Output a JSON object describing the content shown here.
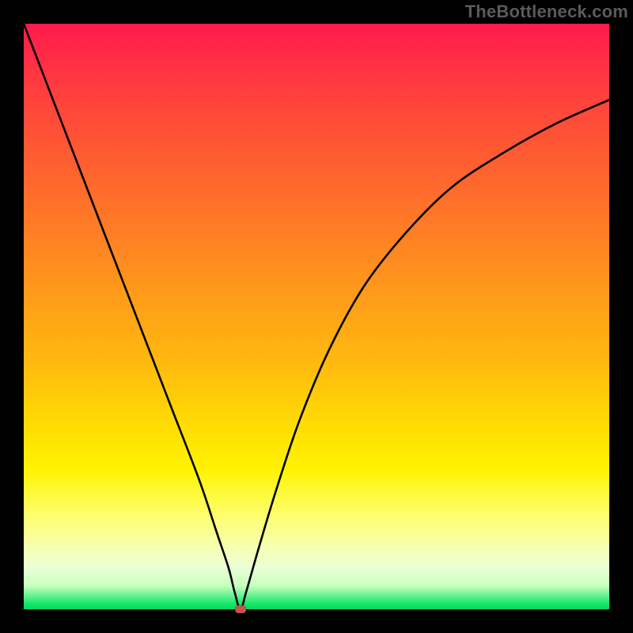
{
  "watermark": {
    "text": "TheBottleneck.com"
  },
  "colors": {
    "frame": "#000000",
    "curve": "#000000",
    "marker": "#c9534b",
    "gradient_stops": [
      {
        "pos": 0.0,
        "color": "#ff1a4d"
      },
      {
        "pos": 0.5,
        "color": "#ffba0e"
      },
      {
        "pos": 0.8,
        "color": "#fff300"
      },
      {
        "pos": 0.95,
        "color": "#c8ffbf"
      },
      {
        "pos": 1.0,
        "color": "#00d85e"
      }
    ]
  },
  "chart_data": {
    "type": "line",
    "title": "",
    "xlabel": "",
    "ylabel": "",
    "xlim": [
      0,
      100
    ],
    "ylim": [
      0,
      100
    ],
    "notes": "Image has no axis ticks, numeric labels, or legend; values are visual estimates of the plotted black curve in percent of plot area. y=0 is the bottom (green), y=100 is the top (red). Minimum near x≈37.",
    "series": [
      {
        "name": "curve",
        "x": [
          0,
          5,
          10,
          15,
          20,
          25,
          30,
          33,
          35,
          36,
          37,
          38,
          40,
          43,
          47,
          52,
          58,
          65,
          73,
          82,
          91,
          100
        ],
        "y": [
          100,
          87,
          74,
          61,
          48,
          35,
          22,
          13,
          7,
          3,
          0,
          3,
          10,
          20,
          32,
          44,
          55,
          64,
          72,
          78,
          83,
          87
        ]
      }
    ],
    "marker": {
      "x": 37,
      "y": 0
    }
  }
}
